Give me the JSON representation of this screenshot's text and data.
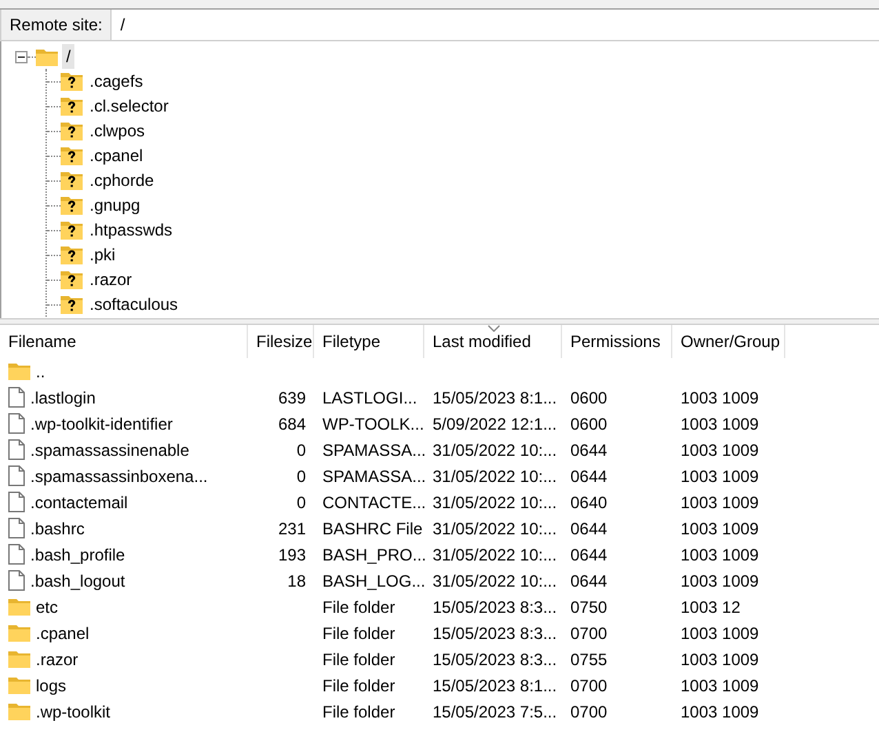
{
  "remote_site": {
    "label": "Remote site:",
    "value": "/"
  },
  "tree": {
    "label": "/",
    "expanded": true,
    "children": [
      {
        "label": ".cagefs"
      },
      {
        "label": ".cl.selector"
      },
      {
        "label": ".clwpos"
      },
      {
        "label": ".cpanel"
      },
      {
        "label": ".cphorde"
      },
      {
        "label": ".gnupg"
      },
      {
        "label": ".htpasswds"
      },
      {
        "label": ".pki"
      },
      {
        "label": ".razor"
      },
      {
        "label": ".softaculous"
      }
    ]
  },
  "table": {
    "columns": [
      {
        "label": "Filename",
        "sorted": false
      },
      {
        "label": "Filesize",
        "sorted": false
      },
      {
        "label": "Filetype",
        "sorted": false
      },
      {
        "label": "Last modified",
        "sorted": true
      },
      {
        "label": "Permissions",
        "sorted": false
      },
      {
        "label": "Owner/Group",
        "sorted": false
      }
    ],
    "rows": [
      {
        "kind": "folder",
        "cells": [
          ".."
        ]
      },
      {
        "kind": "file",
        "cells": [
          ".lastlogin",
          "639",
          "LASTLOGI...",
          "15/05/2023 8:1...",
          "0600",
          "1003 1009"
        ]
      },
      {
        "kind": "file",
        "cells": [
          ".wp-toolkit-identifier",
          "684",
          "WP-TOOLK...",
          "5/09/2022 12:1...",
          "0600",
          "1003 1009"
        ]
      },
      {
        "kind": "file",
        "cells": [
          ".spamassassinenable",
          "0",
          "SPAMASSA...",
          "31/05/2022 10:...",
          "0644",
          "1003 1009"
        ]
      },
      {
        "kind": "file",
        "cells": [
          ".spamassassinboxena...",
          "0",
          "SPAMASSA...",
          "31/05/2022 10:...",
          "0644",
          "1003 1009"
        ]
      },
      {
        "kind": "file",
        "cells": [
          ".contactemail",
          "0",
          "CONTACTE...",
          "31/05/2022 10:...",
          "0640",
          "1003 1009"
        ]
      },
      {
        "kind": "file",
        "cells": [
          ".bashrc",
          "231",
          "BASHRC File",
          "31/05/2022 10:...",
          "0644",
          "1003 1009"
        ]
      },
      {
        "kind": "file",
        "cells": [
          ".bash_profile",
          "193",
          "BASH_PRO...",
          "31/05/2022 10:...",
          "0644",
          "1003 1009"
        ]
      },
      {
        "kind": "file",
        "cells": [
          ".bash_logout",
          "18",
          "BASH_LOG...",
          "31/05/2022 10:...",
          "0644",
          "1003 1009"
        ]
      },
      {
        "kind": "folder",
        "cells": [
          "etc",
          "",
          "File folder",
          "15/05/2023 8:3...",
          "0750",
          "1003 12"
        ]
      },
      {
        "kind": "folder",
        "cells": [
          ".cpanel",
          "",
          "File folder",
          "15/05/2023 8:3...",
          "0700",
          "1003 1009"
        ]
      },
      {
        "kind": "folder",
        "cells": [
          ".razor",
          "",
          "File folder",
          "15/05/2023 8:3...",
          "0755",
          "1003 1009"
        ]
      },
      {
        "kind": "folder",
        "cells": [
          "logs",
          "",
          "File folder",
          "15/05/2023 8:1...",
          "0700",
          "1003 1009"
        ]
      },
      {
        "kind": "folder",
        "cells": [
          ".wp-toolkit",
          "",
          "File folder",
          "15/05/2023 7:5...",
          "0700",
          "1003 1009"
        ]
      }
    ]
  }
}
